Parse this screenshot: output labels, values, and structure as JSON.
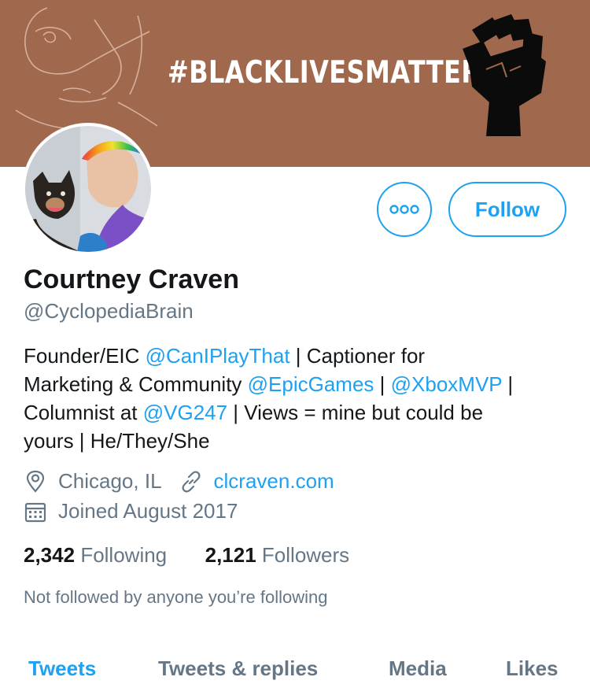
{
  "banner": {
    "hashtag": "#BLACKLIVESMATTER",
    "background_color": "#a0684d"
  },
  "profile": {
    "name": "Courtney Craven",
    "handle": "@CyclopediaBrain",
    "avatar_icon": "profile-photo"
  },
  "actions": {
    "more_icon": "more-dots-icon",
    "follow_label": "Follow",
    "accent_color": "#1da1f2"
  },
  "bio": {
    "l1_a": "Founder/EIC ",
    "l1_mention": "@CanIPlayThat",
    "l1_b": " | Captioner for",
    "l2_a": "Marketing & Community ",
    "l2_mention1": "@EpicGames",
    "l2_b": " | ",
    "l2_mention2": "@XboxMVP",
    "l2_c": " |",
    "l3_a": "Columnist at ",
    "l3_mention": "@VG247",
    "l3_b": " | Views = mine but could be",
    "l4": "yours | He/They/She"
  },
  "meta": {
    "location": "Chicago, IL",
    "website": "clcraven.com",
    "joined": "Joined August 2017"
  },
  "stats": {
    "following_count": "2,342",
    "following_label": "Following",
    "followers_count": "2,121",
    "followers_label": "Followers"
  },
  "mutuals_note": "Not followed by anyone you’re following",
  "tabs": [
    {
      "label": "Tweets",
      "active": true
    },
    {
      "label": "Tweets & replies",
      "active": false
    },
    {
      "label": "Media",
      "active": false
    },
    {
      "label": "Likes",
      "active": false
    }
  ]
}
